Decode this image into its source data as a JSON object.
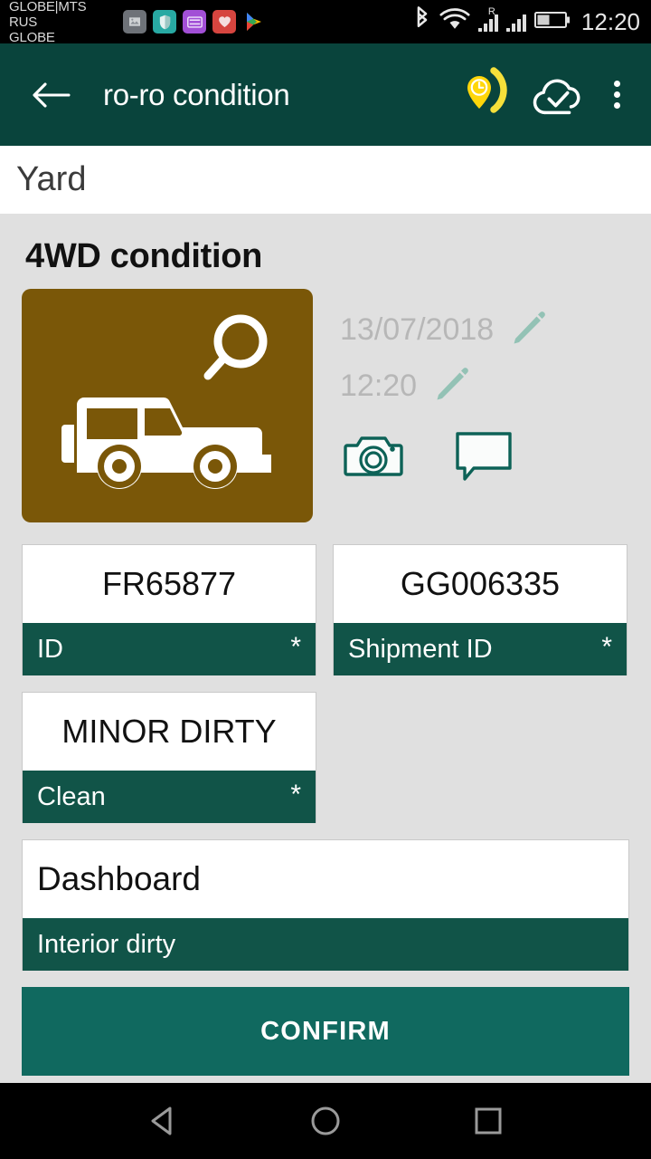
{
  "statusbar": {
    "carrier": "GLOBE|MTS RUS\nGLOBE",
    "time": "12:20",
    "notification_icons": [
      "photo-icon",
      "shield-icon",
      "card-list-icon",
      "heart-icon",
      "play-store-icon"
    ],
    "system_icons": [
      "bluetooth-icon",
      "wifi-icon",
      "signal-roaming-icon",
      "signal-icon",
      "battery-icon"
    ],
    "roaming_label": "R"
  },
  "appbar": {
    "back_label": "Back",
    "title": "ro-ro condition",
    "gps_icon": "location-pin-clock-icon",
    "sync_icon": "cloud-check-icon",
    "overflow_label": "More options"
  },
  "subheader": {
    "title": "Yard"
  },
  "main": {
    "section_title": "4WD condition",
    "vehicle_tile": {
      "name": "vehicle-inspect-tile",
      "color": "#7A5708",
      "icons": [
        "magnifier-icon",
        "suv-4wd-icon"
      ]
    },
    "date": "13/07/2018",
    "time": "12:20",
    "camera_label": "Add photo",
    "comment_label": "Add comment",
    "fields": [
      {
        "value": "FR65877",
        "label": "ID",
        "required": "*",
        "align": "center",
        "width": "half"
      },
      {
        "value": "GG006335",
        "label": "Shipment ID",
        "required": "*",
        "align": "center",
        "width": "half"
      },
      {
        "value": "MINOR DIRTY",
        "label": "Clean",
        "required": "*",
        "align": "center",
        "width": "half"
      },
      {
        "value": "Dashboard",
        "label": "Interior dirty",
        "required": "",
        "align": "left",
        "width": "full"
      }
    ],
    "confirm_label": "CONFIRM"
  },
  "navbar": {
    "back_label": "Back",
    "home_label": "Home",
    "recents_label": "Recents"
  },
  "colors": {
    "appbar": "#09443C",
    "field_label": "#115448",
    "confirm": "#10695F",
    "content_bg": "#E0E0E0",
    "tile": "#7A5708",
    "accent_yellow": "#F6E03A"
  }
}
